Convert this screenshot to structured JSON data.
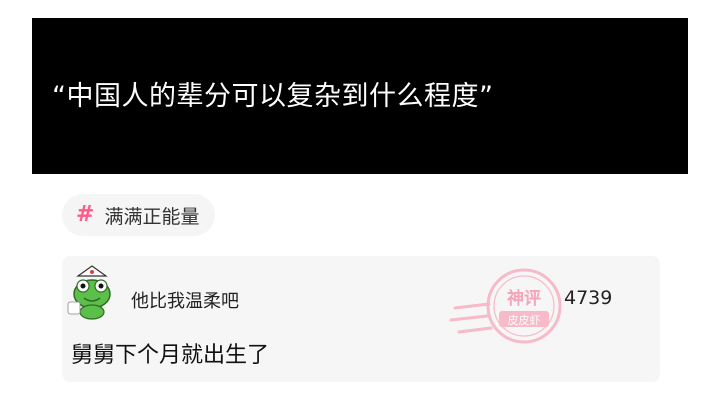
{
  "title": {
    "text": "“中国人的辈分可以复杂到什么程度”"
  },
  "topic": {
    "icon": "hash-icon",
    "label": "满满正能量",
    "accent_color": "#ff5a8a"
  },
  "comment": {
    "avatar": "frog-avatar",
    "username": "他比我温柔吧",
    "like_count": "4739",
    "text": "舅舅下个月就出生了"
  },
  "watermark": {
    "line1": "神评",
    "line2": "皮皮虾",
    "color": "#f06a8c"
  }
}
